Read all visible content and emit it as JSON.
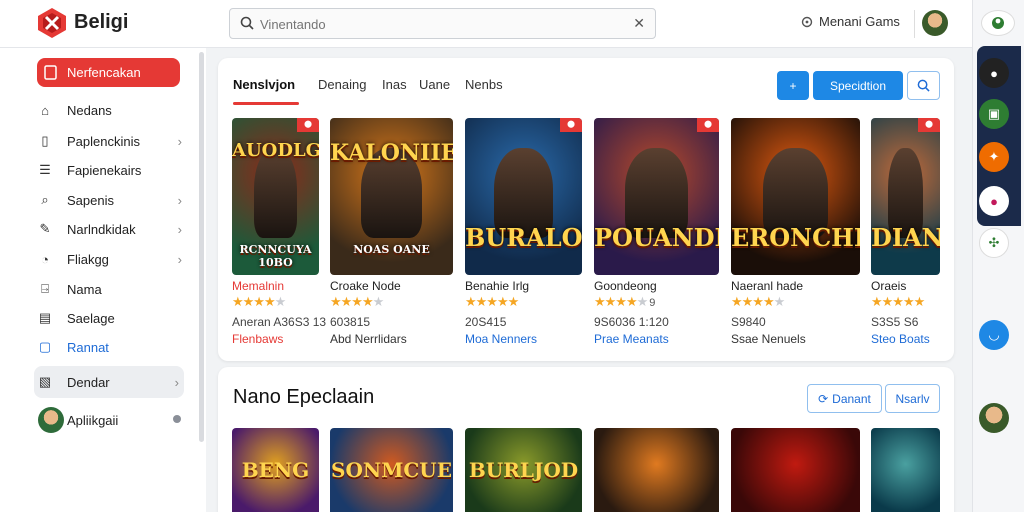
{
  "brand": {
    "name": "Beligi"
  },
  "search": {
    "placeholder": "Vinentando"
  },
  "top": {
    "games_label": "Menani Gams"
  },
  "sidebar": {
    "active": "Nerfencakan",
    "items": [
      {
        "label": "Nedans",
        "icon": "home-icon",
        "chevron": false
      },
      {
        "label": "Paplenckinis",
        "icon": "document-icon",
        "chevron": true
      },
      {
        "label": "Fapienekairs",
        "icon": "list-icon",
        "chevron": false
      },
      {
        "label": "Sapenis",
        "icon": "search-icon",
        "chevron": true
      },
      {
        "label": "Narlndkidak",
        "icon": "pen-icon",
        "chevron": true
      },
      {
        "label": "Fliakgg",
        "icon": "chart-icon",
        "chevron": true
      },
      {
        "label": "Nama",
        "icon": "doc-arrow-icon",
        "chevron": false
      },
      {
        "label": "Saelage",
        "icon": "note-icon",
        "chevron": false
      },
      {
        "label": "Rannat",
        "icon": "frame-icon",
        "chevron": false
      }
    ],
    "box_item": {
      "label": "Dendar"
    },
    "user": {
      "label": "Apliikgaii"
    }
  },
  "tabs": [
    {
      "label": "Nenslvjon",
      "active": true
    },
    {
      "label": "Denaing"
    },
    {
      "label": "Inas"
    },
    {
      "label": "Uane"
    },
    {
      "label": "Nenbs"
    }
  ],
  "actions": {
    "add_label": "+",
    "primary_label": "Specidtion"
  },
  "games": [
    {
      "art": "AUODLGEN",
      "sub": "RCNNCUYA 10BO",
      "name": "Memalnin",
      "name_red": true,
      "stars": 4,
      "count": "",
      "price": "Aneran A36S3 13",
      "tag": "Flenbaws",
      "tag_color": "red",
      "badge": true,
      "colors": [
        "#1c5a3a",
        "#8a2a1a"
      ]
    },
    {
      "art": "KALONIIES",
      "sub": "NOAS OANE",
      "name": "Croake Node",
      "stars": 4,
      "count": "",
      "price": "603815",
      "tag": "Abd Nerrlidars",
      "tag_color": "dark",
      "badge": false,
      "colors": [
        "#3a2a1a",
        "#d8781a"
      ]
    },
    {
      "art": "BURALON",
      "sub": "",
      "name": "Benahie Irlg",
      "stars": 5,
      "count": "",
      "price": "20S415",
      "tag": "Moa Nenners",
      "tag_color": "blue",
      "badge": true,
      "colors": [
        "#102a4a",
        "#2a6aaa"
      ]
    },
    {
      "art": "POUANDBY",
      "sub": "",
      "name": "Goondeong",
      "stars": 4,
      "count": "9",
      "price": "9S6036 1:120",
      "tag": "Prae Meanats",
      "tag_color": "blue",
      "badge": true,
      "colors": [
        "#2a1a4a",
        "#b84a2a"
      ]
    },
    {
      "art": "ERONCHIS",
      "sub": "",
      "name": "Naeranl hade",
      "stars": 4,
      "count": "",
      "price": "S9840",
      "tag": "Ssae Nenuels",
      "tag_color": "dark",
      "badge": false,
      "colors": [
        "#1a0e08",
        "#e05a10"
      ]
    },
    {
      "art": "DIAN",
      "sub": "",
      "name": "Oraeis",
      "stars": 5,
      "count": "",
      "price": "S3S5 S6",
      "tag": "Steo Boats",
      "tag_color": "blue",
      "badge": true,
      "colors": [
        "#0e3a4a",
        "#c06a3a"
      ]
    }
  ],
  "section2": {
    "title": "Nano Epeclaain",
    "btn1": "Danant",
    "btn2": "Nsarlv",
    "games": [
      {
        "art": "BENG",
        "colors": [
          "#4a1a6a",
          "#e0a020"
        ]
      },
      {
        "art": "SONMCUE",
        "colors": [
          "#1a3a6a",
          "#d05a20"
        ]
      },
      {
        "art": "BURLJOD",
        "colors": [
          "#1a3a1a",
          "#8a9a2a"
        ]
      },
      {
        "art": "",
        "colors": [
          "#2a1a10",
          "#e07a20"
        ]
      },
      {
        "art": "",
        "colors": [
          "#3a0808",
          "#c01a10"
        ]
      },
      {
        "art": "",
        "colors": [
          "#0a3a4a",
          "#4aa0a0"
        ]
      }
    ]
  }
}
